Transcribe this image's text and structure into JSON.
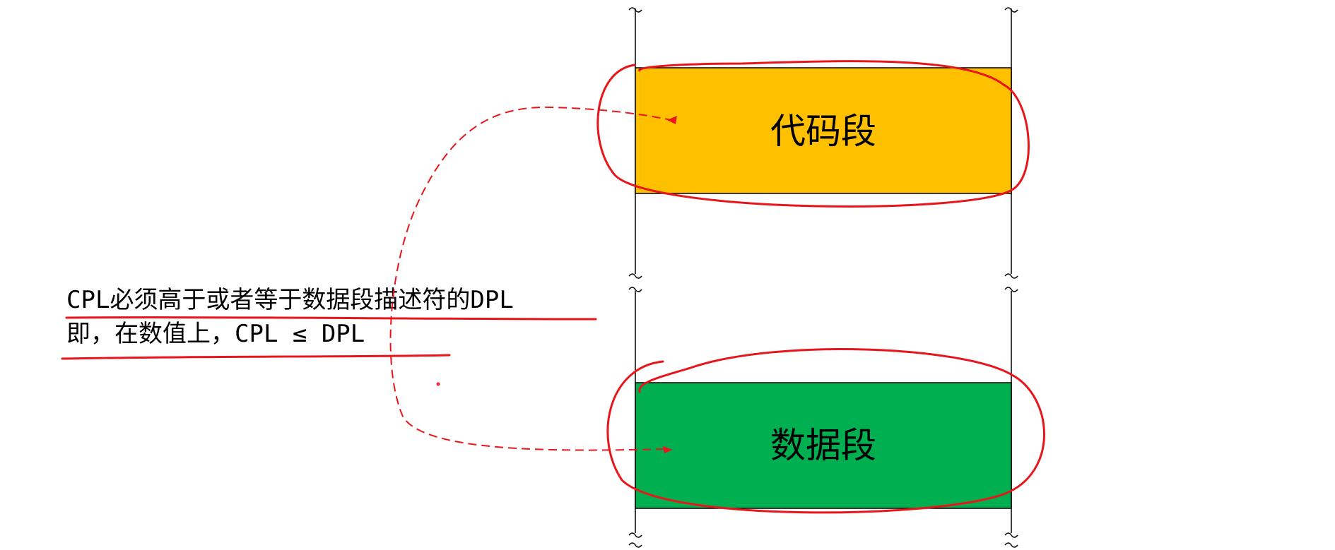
{
  "diagram": {
    "note": {
      "line1": "CPL必须高于或者等于数据段描述符的DPL",
      "line2": "即，在数值上，CPL  ≤  DPL"
    },
    "segments": [
      {
        "label": "代码段",
        "fill": "#FFC000"
      },
      {
        "label": "数据段",
        "fill": "#00B050"
      }
    ],
    "colors": {
      "annotation": "#E8151B",
      "border": "#000000"
    }
  }
}
